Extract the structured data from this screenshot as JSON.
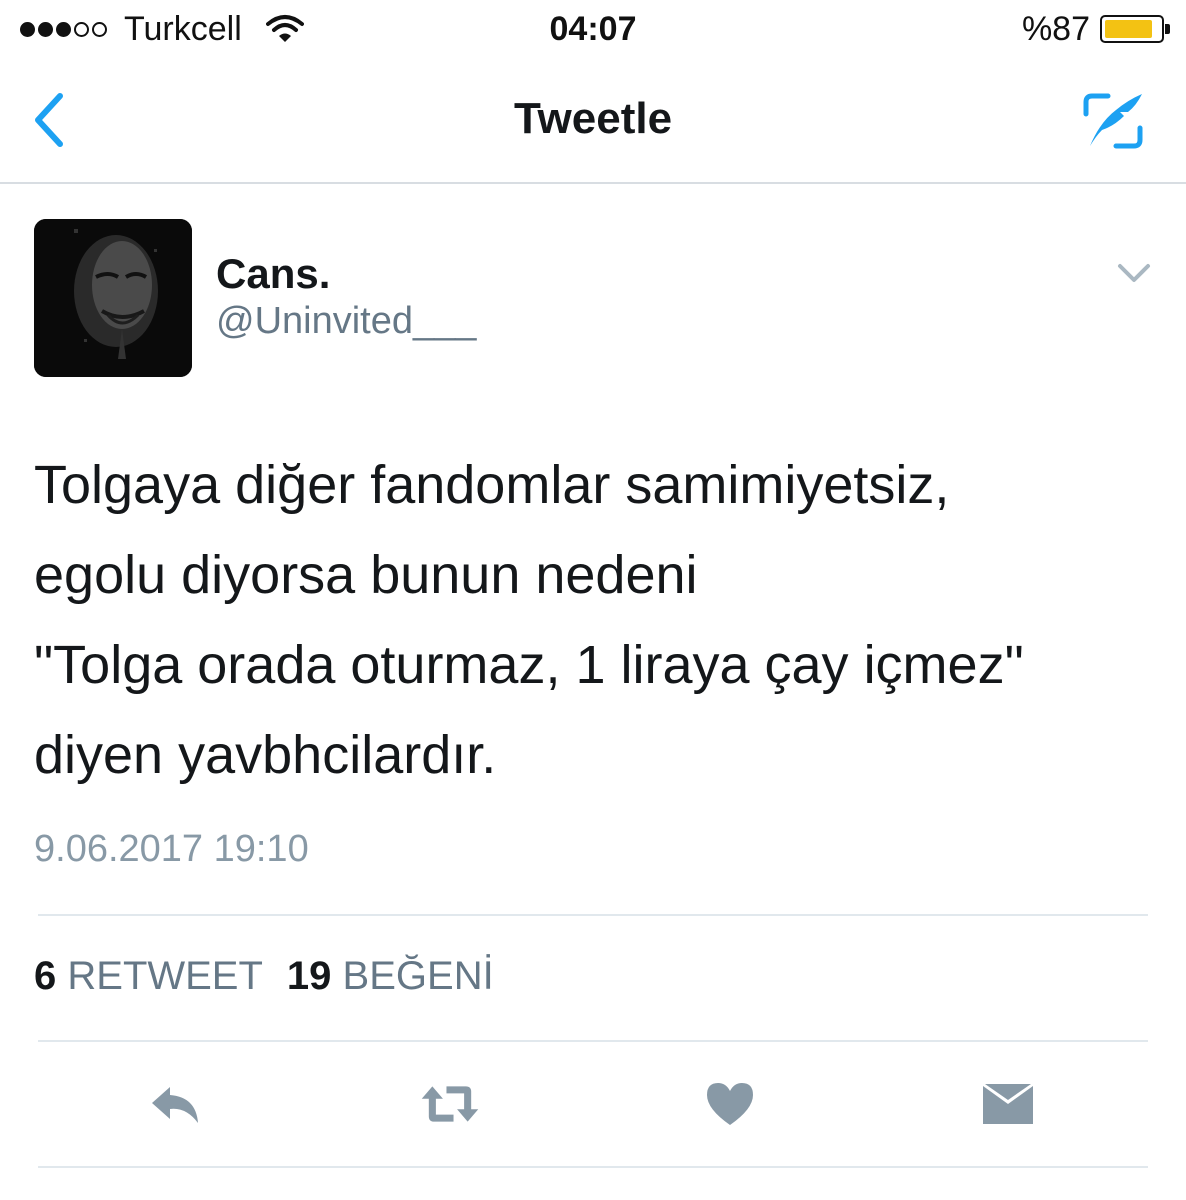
{
  "status_bar": {
    "carrier": "Turkcell",
    "time": "04:07",
    "battery": "%87",
    "battery_level": 0.87,
    "signal_bars": 3,
    "signal_total": 5
  },
  "nav": {
    "title": "Tweetle",
    "back_icon": "chevron-left-icon",
    "compose_icon": "compose-tweet-icon",
    "accent_color": "#1da1f2"
  },
  "tweet": {
    "display_name": "Cans.",
    "handle": "@Uninvited___",
    "avatar": "anonymous-mask-avatar",
    "text_lines": [
      "Tolgaya diğer fandomlar samimiyetsiz,",
      "egolu diyorsa bunun nedeni",
      "\"Tolga orada oturmaz, 1 liraya çay içmez\"",
      "diyen yavbhcilardır."
    ],
    "timestamp": "9.06.2017 19:10",
    "retweet_count": "6",
    "retweet_label": "RETWEET",
    "like_count": "19",
    "like_label": "BEĞENİ"
  },
  "actions": [
    {
      "name": "reply",
      "icon": "reply-icon"
    },
    {
      "name": "retweet",
      "icon": "retweet-icon"
    },
    {
      "name": "like",
      "icon": "heart-icon"
    },
    {
      "name": "direct-message",
      "icon": "envelope-icon"
    }
  ],
  "colors": {
    "accent": "#1da1f2",
    "icon_gray": "#8899a6",
    "secondary_text": "#657786"
  }
}
